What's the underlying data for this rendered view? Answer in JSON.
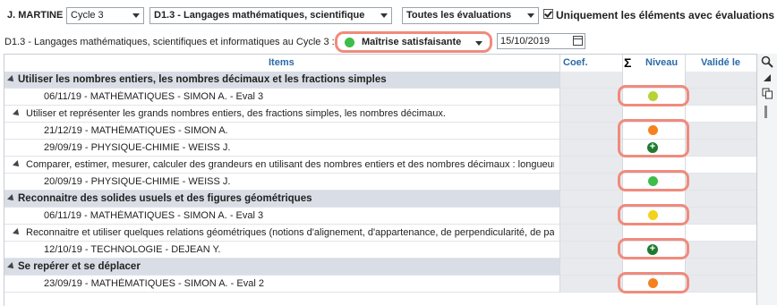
{
  "filters": {
    "student": "J. MARTINE",
    "cycle": "Cycle 3",
    "domain": "D1.3 - Langages mathématiques, scientifique",
    "evaluations": "Toutes les évaluations",
    "only_with_evals_label": "Uniquement les éléments avec évaluations",
    "only_with_evals_checked": true
  },
  "assessment": {
    "label": "D1.3 - Langages mathématiques, scientifiques et informatiques au Cycle 3 :",
    "level": "Maîtrise satisfaisante",
    "level_color": "#3dbd4a",
    "date": "15/10/2019"
  },
  "table": {
    "headers": {
      "items": "Items",
      "coef": "Coef.",
      "sigma": "Σ",
      "niveau": "Niveau",
      "valide": "Validé le"
    },
    "rows": [
      {
        "type": "group",
        "text": "Utiliser les nombres entiers, les nombres décimaux et les fractions simples"
      },
      {
        "type": "eval",
        "text": "06/11/19 - MATHÉMATIQUES - SIMON A. - Eval 3",
        "mark": "dot",
        "color": "#b5d334"
      },
      {
        "type": "sub",
        "text": "Utiliser et représenter les grands nombres entiers, des fractions simples, les nombres décimaux."
      },
      {
        "type": "eval",
        "text": "21/12/19 - MATHÉMATIQUES - SIMON A.",
        "mark": "dot",
        "color": "#f5821f"
      },
      {
        "type": "eval",
        "text": "29/09/19 - PHYSIQUE-CHIMIE - WEISS J.",
        "mark": "plus",
        "color": "#1f7a2f"
      },
      {
        "type": "sub",
        "text": "Comparer, estimer, mesurer, calculer des grandeurs en utilisant des nombres entiers et des nombres décimaux : longueur"
      },
      {
        "type": "eval",
        "text": "20/09/19 - PHYSIQUE-CHIMIE - WEISS J.",
        "mark": "dot",
        "color": "#3dbd4a"
      },
      {
        "type": "group",
        "text": "Reconnaitre des solides usuels et des figures géométriques"
      },
      {
        "type": "eval",
        "text": "06/11/19 - MATHÉMATIQUES - SIMON A. - Eval 3",
        "mark": "dot",
        "color": "#f2d21b"
      },
      {
        "type": "sub",
        "text": "Reconnaitre et utiliser quelques relations géométriques (notions d'alignement, d'appartenance, de perpendicularité, de para"
      },
      {
        "type": "eval",
        "text": "12/10/19 - TECHNOLOGIE - DEJEAN Y.",
        "mark": "plus",
        "color": "#1f7a2f"
      },
      {
        "type": "group",
        "text": "Se repérer et se déplacer"
      },
      {
        "type": "eval",
        "text": "23/09/19 - MATHÉMATIQUES - SIMON A. - Eval 2",
        "mark": "dot",
        "color": "#f5821f"
      }
    ]
  },
  "tools": {
    "search_icon": "search-icon",
    "collapse_icon": "triangle-icon",
    "copy_icon": "copy-icon"
  }
}
